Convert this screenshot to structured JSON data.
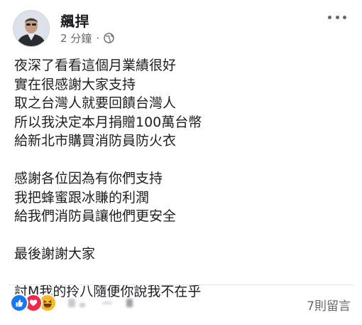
{
  "post": {
    "author": "飆捍",
    "time": "2 分鐘",
    "separator": "·",
    "privacy_icon": "globe-icon",
    "menu_icon": "more-horizontal-icon"
  },
  "content": {
    "paragraphs": [
      [
        "夜深了看看這個月業績很好",
        "實在很感謝大家支持",
        "取之台灣人就要回饋台灣人",
        "所以我決定本月捐贈100萬台幣",
        "給新北市購買消防員防火衣"
      ],
      [
        "感謝各位因為有你們支持",
        "我把蜂蜜跟冰賺的利潤",
        "給我們消防員讓他們更安全"
      ],
      [
        "最後謝謝大家"
      ],
      [
        "討M我的拎八隨便你說我不在乎"
      ]
    ]
  },
  "footer": {
    "reactions": [
      "like-icon",
      "love-icon",
      "haha-icon"
    ],
    "comments_label": "7則留言"
  },
  "colors": {
    "like": "#1877f2",
    "love": "#f0284a",
    "haha": "#f7b928",
    "meta_text": "#65676b",
    "body_text": "#1c1e21"
  }
}
